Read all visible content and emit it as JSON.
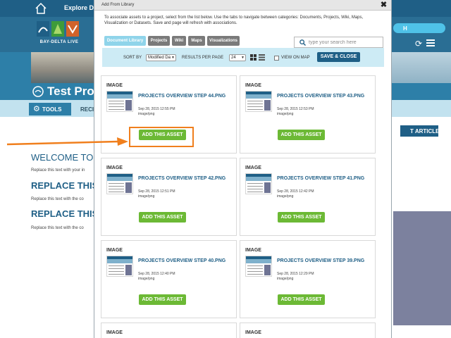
{
  "site": {
    "nav_label": "Explore Dat",
    "logo_text": "BAY-DELTA LIVE",
    "search_label": "H",
    "project_title": "Test Proj",
    "tools_label": "TOOLS",
    "rec_tab": "RECI",
    "article_button": "T ARTICLE",
    "welcome_heading": "WELCOME TO H",
    "sections": [
      {
        "text": "Replace this text with your in"
      },
      {
        "heading": "REPLACE THIS T",
        "text": "Replace this text with the co"
      },
      {
        "heading": "REPLACE THIS T",
        "text": "Replace this text with the co"
      }
    ]
  },
  "modal": {
    "title": "Add From Library",
    "description": "To associate assets to a project, select from the list below. Use the tabs to navigate between categories: Documents, Projects, Wiki, Maps, Visualization or Datasets. Save and page will refresh with associations.",
    "tabs": [
      {
        "label": "Document Library",
        "active": true
      },
      {
        "label": "Projects",
        "active": false
      },
      {
        "label": "Wiki",
        "active": false
      },
      {
        "label": "Maps",
        "active": false
      },
      {
        "label": "Visualizations",
        "active": false
      }
    ],
    "search_placeholder": "type your search here",
    "sort_label": "SORT BY",
    "sort_value": "Modified Da",
    "results_label": "RESULTS PER PAGE",
    "results_value": "24",
    "view_on_map_label": "VIEW ON MAP",
    "view_on_map_checked": false,
    "save_button": "SAVE & CLOSE",
    "add_button_label": "ADD THIS ASSET",
    "assets": [
      {
        "type": "IMAGE",
        "title": "PROJECTS OVERVIEW STEP 44.PNG",
        "date": "Sep 28, 2015 12:55 PM",
        "mime": "image/png"
      },
      {
        "type": "IMAGE",
        "title": "PROJECTS OVERVIEW STEP 43.PNG",
        "date": "Sep 28, 2015 12:53 PM",
        "mime": "image/png"
      },
      {
        "type": "IMAGE",
        "title": "PROJECTS OVERVIEW STEP 42.PNG",
        "date": "Sep 28, 2015 12:51 PM",
        "mime": "image/png"
      },
      {
        "type": "IMAGE",
        "title": "PROJECTS OVERVIEW STEP 41.PNG",
        "date": "Sep 28, 2015 12:42 PM",
        "mime": "image/png"
      },
      {
        "type": "IMAGE",
        "title": "PROJECTS OVERVIEW STEP 40.PNG",
        "date": "Sep 28, 2015 12:40 PM",
        "mime": "image/png"
      },
      {
        "type": "IMAGE",
        "title": "PROJECTS OVERVIEW STEP 39.PNG",
        "date": "Sep 28, 2015 12:29 PM",
        "mime": "image/png"
      },
      {
        "type": "IMAGE"
      },
      {
        "type": "IMAGE"
      }
    ]
  },
  "colors": {
    "nav_blue": "#1f5f86",
    "banner_blue": "#2d7fa8",
    "toolbar_light": "#c2e2ef",
    "add_button_green": "#6cb935",
    "highlight_orange": "#f07f1d"
  },
  "icons": [
    "home-icon",
    "refresh-icon",
    "list-icon",
    "gear-icon",
    "close-icon",
    "search-icon",
    "grid-view-icon",
    "list-view-icon",
    "arrow-pointer"
  ]
}
